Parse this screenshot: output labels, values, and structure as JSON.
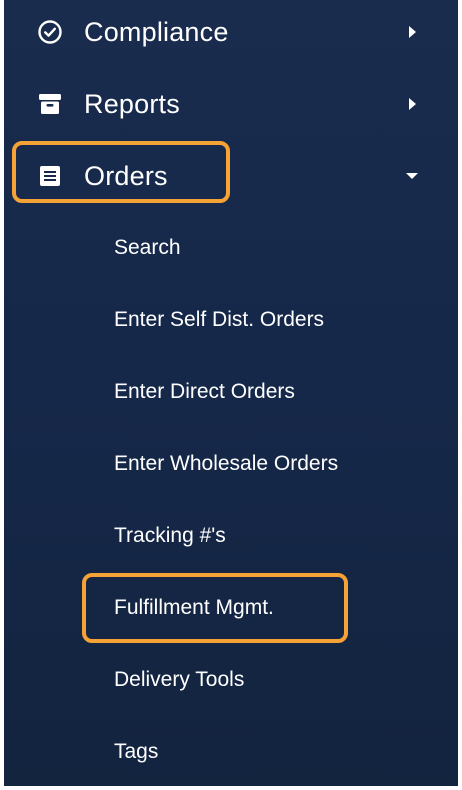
{
  "colors": {
    "sidebar_bg": "#16284a",
    "text": "#ffffff",
    "highlight": "#f5a236"
  },
  "nav": {
    "items": [
      {
        "label": "Compliance",
        "icon": "check-circle-icon",
        "chevron": "chevron-right-icon",
        "expanded": false
      },
      {
        "label": "Reports",
        "icon": "archive-box-icon",
        "chevron": "chevron-right-icon",
        "expanded": false
      },
      {
        "label": "Orders",
        "icon": "list-document-icon",
        "chevron": "caret-down-icon",
        "expanded": true,
        "highlighted": true
      }
    ]
  },
  "orders_submenu": {
    "items": [
      {
        "label": "Search"
      },
      {
        "label": "Enter Self Dist. Orders"
      },
      {
        "label": "Enter Direct Orders"
      },
      {
        "label": "Enter Wholesale Orders"
      },
      {
        "label": "Tracking #'s"
      },
      {
        "label": "Fulfillment Mgmt.",
        "highlighted": true
      },
      {
        "label": "Delivery Tools"
      },
      {
        "label": "Tags"
      }
    ]
  }
}
